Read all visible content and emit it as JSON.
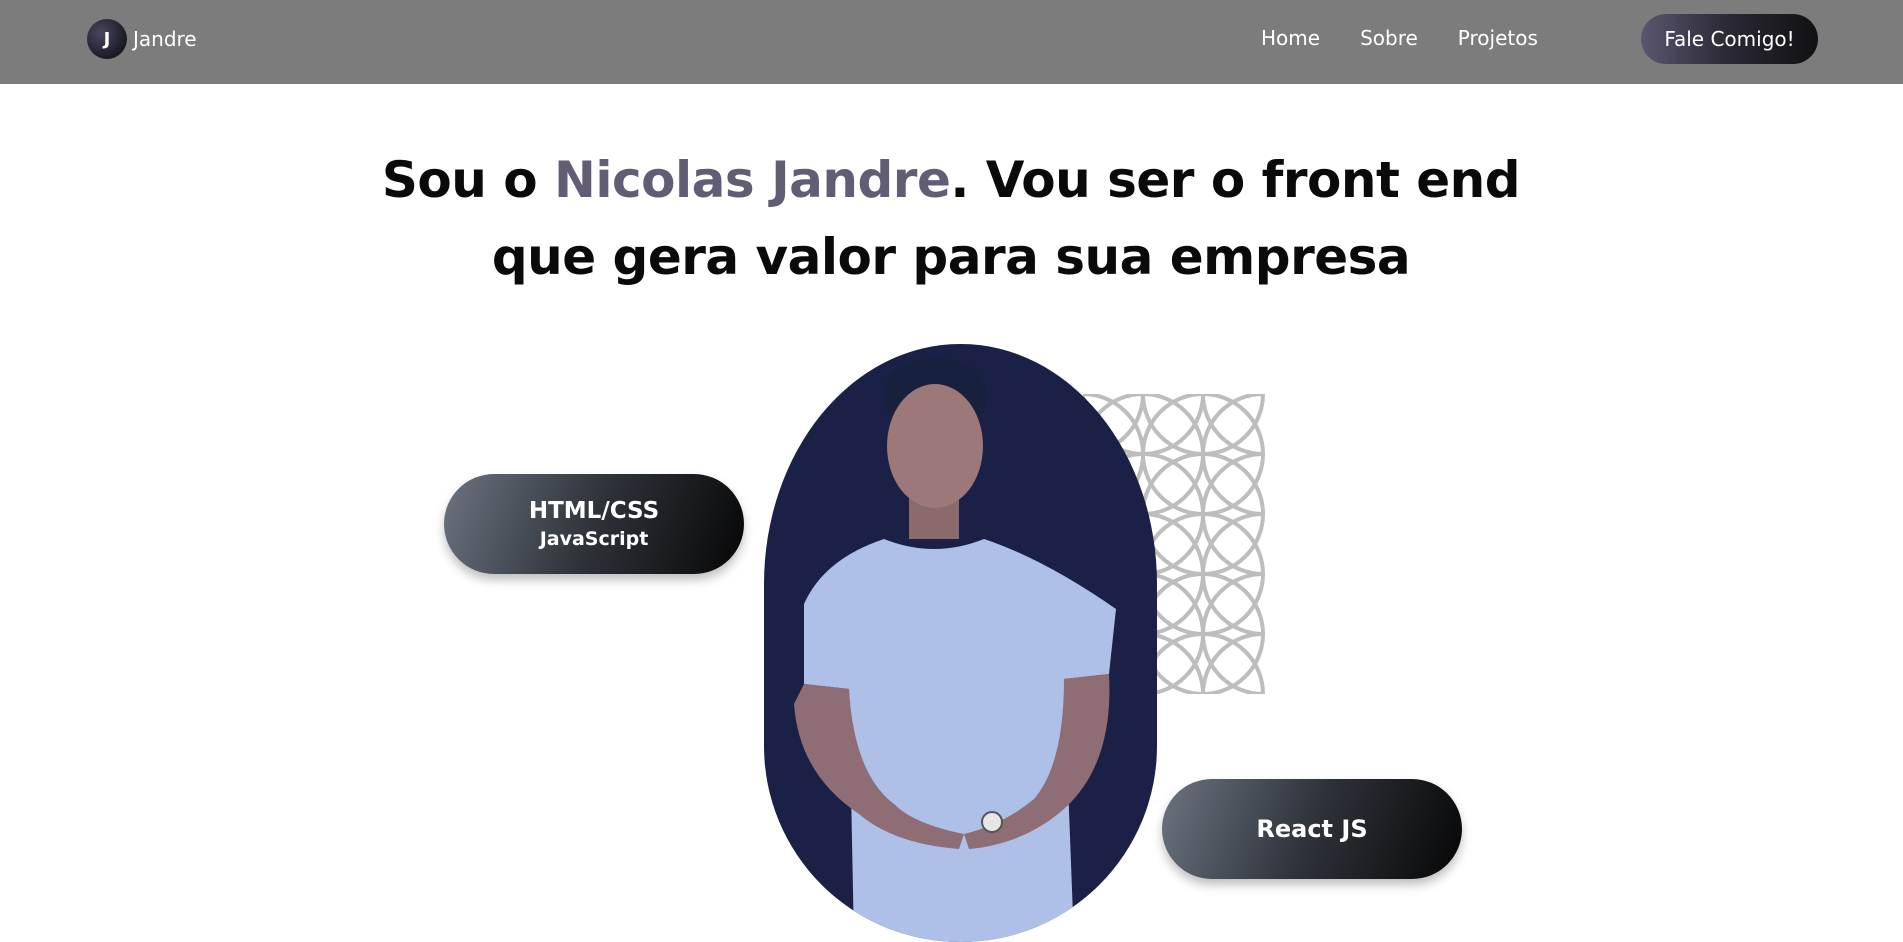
{
  "navbar": {
    "brand_initial": "J",
    "brand_name": "Jandre",
    "links": [
      {
        "label": "Home"
      },
      {
        "label": "Sobre"
      },
      {
        "label": "Projetos"
      }
    ],
    "cta_label": "Fale Comigo!",
    "background_color": "#7c7c7c"
  },
  "hero": {
    "headline_prefix": "Sou o ",
    "headline_name": "Nicolas Jandre",
    "headline_rest_line1": ". Vou ser o front end",
    "headline_line2": "que gera valor para sua empresa",
    "name_color": "#625c75"
  },
  "skills": {
    "left_line1": "HTML/CSS",
    "left_line2": "JavaScript",
    "right_line1": "React JS"
  },
  "portrait": {
    "background_color": "#1b2046"
  }
}
